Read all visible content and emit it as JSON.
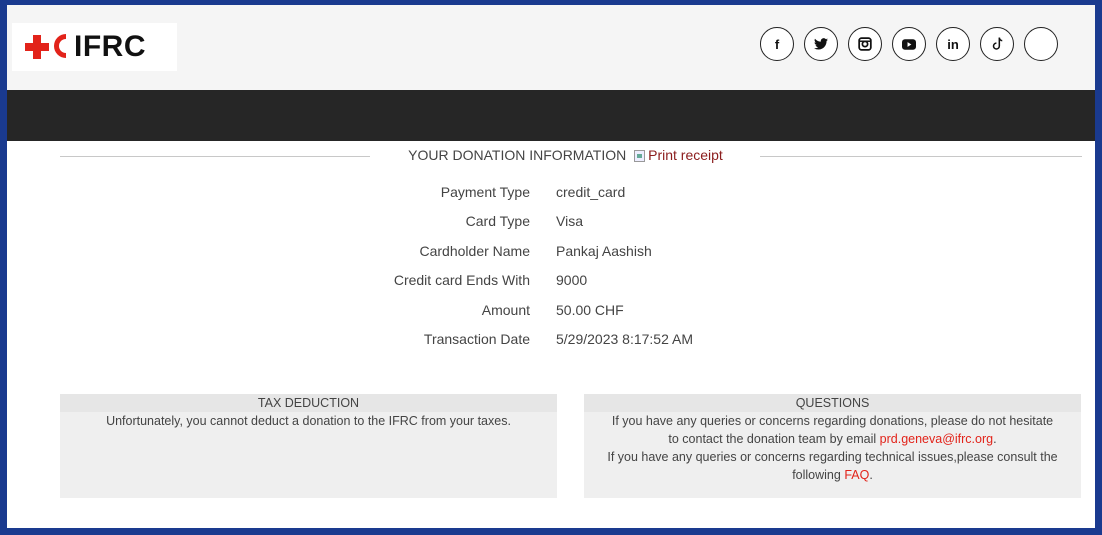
{
  "header": {
    "logo_text": "IFRC",
    "social": [
      {
        "name": "facebook-icon",
        "glyph": "f"
      },
      {
        "name": "twitter-icon",
        "glyph": "🐦"
      },
      {
        "name": "instagram-icon",
        "glyph": "◘"
      },
      {
        "name": "youtube-icon",
        "glyph": "▶"
      },
      {
        "name": "linkedin-icon",
        "glyph": "in"
      },
      {
        "name": "tiktok-icon",
        "glyph": "♪"
      }
    ]
  },
  "donation": {
    "section_title": "YOUR DONATION INFORMATION",
    "print_receipt": "Print receipt",
    "rows": [
      {
        "label": "Payment Type",
        "value": "credit_card"
      },
      {
        "label": "Card Type",
        "value": "Visa"
      },
      {
        "label": "Cardholder Name",
        "value": "Pankaj Aashish"
      },
      {
        "label": "Credit card Ends With",
        "value": "9000"
      },
      {
        "label": "Amount",
        "value": "50.00 CHF"
      },
      {
        "label": "Transaction Date",
        "value": "5/29/2023 8:17:52 AM"
      }
    ]
  },
  "tax": {
    "heading": "TAX DEDUCTION",
    "text": "Unfortunately, you cannot deduct a donation to the IFRC from your taxes."
  },
  "questions": {
    "heading": "QUESTIONS",
    "line1_a": "If you have any queries or concerns regarding donations, please do not hesitate",
    "line1_b": "to contact the donation team by email ",
    "email": "prd.geneva@ifrc.org",
    "line1_end": ".",
    "line2_a": "If you have any queries or concerns regarding technical issues,please consult the",
    "line2_b": "following ",
    "faq": "FAQ",
    "line2_end": "."
  }
}
